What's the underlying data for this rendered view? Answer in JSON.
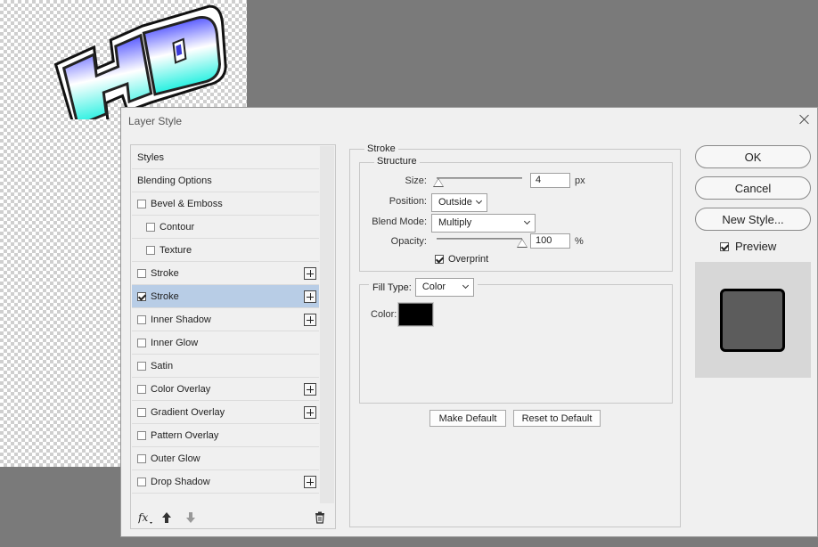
{
  "canvas": {
    "art_text": "HD"
  },
  "dialog": {
    "title": "Layer Style",
    "styles_list": [
      {
        "label": "Styles",
        "checkbox": false,
        "checked": false,
        "plus": false,
        "indent": false,
        "selected": false
      },
      {
        "label": "Blending Options",
        "checkbox": false,
        "checked": false,
        "plus": false,
        "indent": false,
        "selected": false
      },
      {
        "label": "Bevel & Emboss",
        "checkbox": true,
        "checked": false,
        "plus": false,
        "indent": false,
        "selected": false
      },
      {
        "label": "Contour",
        "checkbox": true,
        "checked": false,
        "plus": false,
        "indent": true,
        "selected": false
      },
      {
        "label": "Texture",
        "checkbox": true,
        "checked": false,
        "plus": false,
        "indent": true,
        "selected": false
      },
      {
        "label": "Stroke",
        "checkbox": true,
        "checked": false,
        "plus": true,
        "indent": false,
        "selected": false
      },
      {
        "label": "Stroke",
        "checkbox": true,
        "checked": true,
        "plus": true,
        "indent": false,
        "selected": true
      },
      {
        "label": "Inner Shadow",
        "checkbox": true,
        "checked": false,
        "plus": true,
        "indent": false,
        "selected": false
      },
      {
        "label": "Inner Glow",
        "checkbox": true,
        "checked": false,
        "plus": false,
        "indent": false,
        "selected": false
      },
      {
        "label": "Satin",
        "checkbox": true,
        "checked": false,
        "plus": false,
        "indent": false,
        "selected": false
      },
      {
        "label": "Color Overlay",
        "checkbox": true,
        "checked": false,
        "plus": true,
        "indent": false,
        "selected": false
      },
      {
        "label": "Gradient Overlay",
        "checkbox": true,
        "checked": false,
        "plus": true,
        "indent": false,
        "selected": false
      },
      {
        "label": "Pattern Overlay",
        "checkbox": true,
        "checked": false,
        "plus": false,
        "indent": false,
        "selected": false
      },
      {
        "label": "Outer Glow",
        "checkbox": true,
        "checked": false,
        "plus": false,
        "indent": false,
        "selected": false
      },
      {
        "label": "Drop Shadow",
        "checkbox": true,
        "checked": false,
        "plus": true,
        "indent": false,
        "selected": false
      }
    ],
    "bottom_icons": [
      "fx-icon",
      "move-up-icon",
      "move-down-icon",
      "trash-icon"
    ],
    "stroke": {
      "section_title": "Stroke",
      "structure_title": "Structure",
      "size_label": "Size:",
      "size_value": "4",
      "size_unit": "px",
      "size_slider_fraction": 0.02,
      "position_label": "Position:",
      "position_value": "Outside",
      "blend_mode_label": "Blend Mode:",
      "blend_mode_value": "Multiply",
      "opacity_label": "Opacity:",
      "opacity_value": "100",
      "opacity_unit": "%",
      "opacity_slider_fraction": 1.0,
      "overprint_label": "Overprint",
      "overprint_checked": true,
      "fill_type_label": "Fill Type:",
      "fill_type_value": "Color",
      "color_label": "Color:",
      "color_value": "#000000",
      "make_default_label": "Make Default",
      "reset_default_label": "Reset to Default"
    },
    "actions": {
      "ok_label": "OK",
      "cancel_label": "Cancel",
      "new_style_label": "New Style...",
      "preview_label": "Preview",
      "preview_checked": true
    }
  },
  "colors": {
    "selection": "#b8cde6",
    "canvas_bg": "#7a7a7a",
    "preview_fill": "#5c5c5c"
  }
}
